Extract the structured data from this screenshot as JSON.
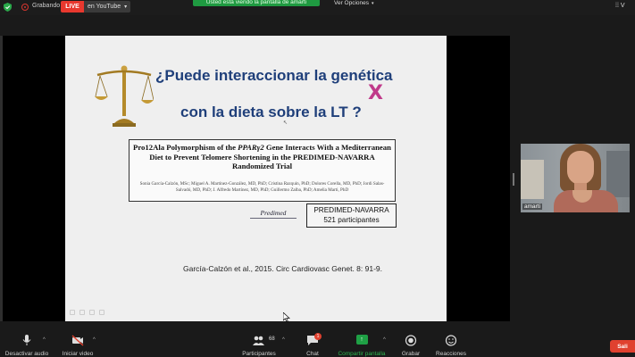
{
  "top_bar": {
    "recording_label": "Grabando",
    "live_badge": "LIVE",
    "youtube_label": "en YouTube",
    "share_banner": "Usted está viendo la pantalla de amarti",
    "view_options": "Ver Opciones",
    "view_button": "V",
    "icons": [
      "shield-icon",
      "recording-icon",
      "chevron-down-icon"
    ]
  },
  "slide": {
    "question_line1": "¿Puede interaccionar la genética",
    "question_line2": "con la dieta sobre la  LT ?",
    "paper_title_a": "Pro12Ala Polymorphism of the ",
    "paper_title_gene": "PPARγ2",
    "paper_title_b": " Gene Interacts With a Mediterranean Diet to Prevent Telomere Shortening in the PREDIMED-NAVARRA Randomized Trial",
    "paper_authors": "Sonia García-Calzón, MSc; Miguel A. Martínez-González, MD, PhD; Cristina Razquin, PhD; Dolores Corella, MD, PhD; Jordi Salas-Salvadó, MD, PhD; J. Alfredo Martínez, MD, PhD; Guillermo Zalba, PhD; Amelia Marti, PhD",
    "logo_text": "Predimed",
    "box_line1": "PREDIMED-NAVARRA",
    "box_line2": "521 participantes",
    "citation": "García-Calzón et al., 2015.  Circ Cardiovasc Genet. 8: 91-9.",
    "colors": {
      "title_blue": "#1f3f7a",
      "dna_magenta": "#c03a8a"
    }
  },
  "video": {
    "participant_name": "amarti"
  },
  "toolbar": {
    "mute_label": "Desactivar audio",
    "video_label": "Iniciar video",
    "participants_label": "Participantes",
    "participants_count": "68",
    "chat_label": "Chat",
    "chat_badge": "1",
    "share_label": "Compartir pantalla",
    "record_label": "Grabar",
    "reactions_label": "Reacciones",
    "leave_label": "Sali",
    "accent_green": "#2fb34f",
    "leave_red": "#e0412f"
  }
}
